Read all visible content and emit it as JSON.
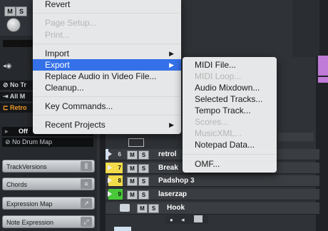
{
  "inspector": {
    "ms": [
      "M",
      "S"
    ],
    "rows": [
      {
        "label": "No Tr",
        "orange": false
      },
      {
        "label": "All M",
        "orange": false
      },
      {
        "label": "Retro",
        "orange": true
      }
    ],
    "off_label": "Off",
    "drum_map_label": "No Drum Map",
    "panels": [
      {
        "label": "TrackVersions",
        "icon": "versions-icon"
      },
      {
        "label": "Chords",
        "icon": "chords-icon"
      },
      {
        "label": "Expression Map",
        "icon": "expression-map-icon"
      },
      {
        "label": "Note Expression",
        "icon": "note-expression-icon"
      }
    ]
  },
  "tracks": [
    {
      "num": "6",
      "name": "retrol",
      "color": "#cfe0ef"
    },
    {
      "num": "7",
      "name": "Break",
      "color": "#f2dc4a"
    },
    {
      "num": "8",
      "name": "Padshop 3",
      "color": "#f2dc4a"
    },
    {
      "num": "9",
      "name": "laserzap",
      "color": "#49c93a"
    }
  ],
  "folder_track": {
    "name": "Hook"
  },
  "file_menu": {
    "items": [
      {
        "label": "Revert",
        "disabled": false
      },
      {
        "label": "Page Setup...",
        "disabled": true
      },
      {
        "label": "Print...",
        "disabled": true
      },
      {
        "label": "Import",
        "disabled": false,
        "submenu": true
      },
      {
        "label": "Export",
        "disabled": false,
        "submenu": true,
        "highlighted": true
      },
      {
        "label": "Replace Audio in Video File...",
        "disabled": false
      },
      {
        "label": "Cleanup...",
        "disabled": false
      },
      {
        "label": "Key Commands...",
        "disabled": false
      },
      {
        "label": "Recent Projects",
        "disabled": false,
        "submenu": true
      }
    ]
  },
  "export_menu": {
    "items": [
      {
        "label": "MIDI File...",
        "disabled": false
      },
      {
        "label": "MIDI Loop...",
        "disabled": true
      },
      {
        "label": "Audio Mixdown...",
        "disabled": false
      },
      {
        "label": "Selected Tracks...",
        "disabled": false
      },
      {
        "label": "Tempo Track...",
        "disabled": false
      },
      {
        "label": "Scores...",
        "disabled": true
      },
      {
        "label": "MusicXML...",
        "disabled": true
      },
      {
        "label": "Notepad Data...",
        "disabled": false
      },
      {
        "label": "OMF...",
        "disabled": false
      }
    ]
  },
  "colors": {
    "menu_highlight": "#3470e8",
    "retro_orange": "#f09a2a",
    "event_purple": "#c07ad8"
  }
}
